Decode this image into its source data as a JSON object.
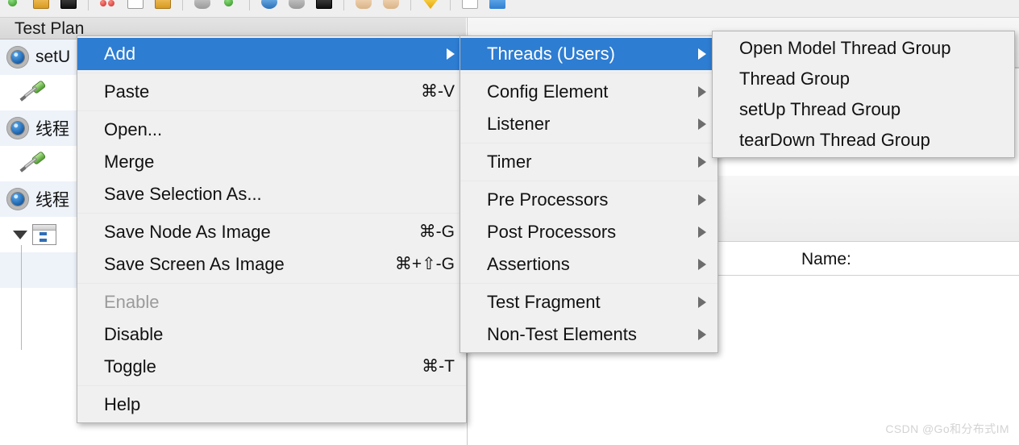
{
  "app": {
    "tree_header": "Test Plan",
    "watermark": "CSDN @Go和分布式IM"
  },
  "toolbar": {
    "icons": [
      {
        "name": "new-icon",
        "shape": "ico-green"
      },
      {
        "name": "open-folder-icon",
        "shape": "ico-folder"
      },
      {
        "name": "save-icon",
        "shape": "ico-disk"
      },
      {
        "name": "separator",
        "shape": "sep"
      },
      {
        "name": "cut-icon",
        "shape": "ico-dots"
      },
      {
        "name": "copy-icon",
        "shape": "ico-page"
      },
      {
        "name": "paste-icon",
        "shape": "ico-folder"
      },
      {
        "name": "separator",
        "shape": "sep"
      },
      {
        "name": "undo-icon",
        "shape": "ico-gray"
      },
      {
        "name": "redo-icon",
        "shape": "ico-green"
      },
      {
        "name": "separator",
        "shape": "sep"
      },
      {
        "name": "start-icon",
        "shape": "ico-multi"
      },
      {
        "name": "start-no-pause-icon",
        "shape": "ico-gray"
      },
      {
        "name": "stop-icon",
        "shape": "ico-disk"
      },
      {
        "name": "separator",
        "shape": "sep"
      },
      {
        "name": "shutdown-icon",
        "shape": "ico-hand"
      },
      {
        "name": "clear-icon",
        "shape": "ico-hand"
      },
      {
        "name": "separator",
        "shape": "sep"
      },
      {
        "name": "search-icon",
        "shape": "ico-shield"
      },
      {
        "name": "separator",
        "shape": "sep"
      },
      {
        "name": "function-helper-icon",
        "shape": "ico-white"
      },
      {
        "name": "help-icon",
        "shape": "ico-blue"
      }
    ]
  },
  "tree": {
    "header": "Test Plan",
    "rows": [
      {
        "icon": "gear-icon",
        "label": "setU",
        "kind": "gear",
        "selected": true
      },
      {
        "icon": "screwdriver-icon",
        "label": "",
        "kind": "screwdriver",
        "selected": false
      },
      {
        "icon": "gear-icon",
        "label": "线程",
        "kind": "gear",
        "selected": true
      },
      {
        "icon": "screwdriver-icon",
        "label": "",
        "kind": "screwdriver",
        "selected": false
      },
      {
        "icon": "gear-icon",
        "label": "线程",
        "kind": "gear",
        "selected": true
      },
      {
        "icon": "controller-icon",
        "label": "",
        "kind": "controller",
        "selected": false
      },
      {
        "icon": "child-node-icon",
        "label": "",
        "kind": "child",
        "selected": true
      },
      {
        "icon": "child-node-icon",
        "label": "",
        "kind": "child",
        "selected": false
      }
    ]
  },
  "content": {
    "name_label": "Name:"
  },
  "context_menu": {
    "name": "tree-context-menu",
    "items": [
      {
        "label": "Add",
        "accel": "",
        "submenu": true,
        "highlight": true,
        "disabled": false
      },
      {
        "separator_after": false
      },
      {
        "label": "Paste",
        "accel": "⌘-V",
        "submenu": false,
        "highlight": false,
        "disabled": false
      },
      {
        "label": "Open...",
        "accel": "",
        "submenu": false,
        "highlight": false,
        "disabled": false
      },
      {
        "label": "Merge",
        "accel": "",
        "submenu": false,
        "highlight": false,
        "disabled": false
      },
      {
        "label": "Save Selection As...",
        "accel": "",
        "submenu": false,
        "highlight": false,
        "disabled": false
      },
      {
        "label": "Save Node As Image",
        "accel": "⌘-G",
        "submenu": false,
        "highlight": false,
        "disabled": false
      },
      {
        "label": "Save Screen As Image",
        "accel": "⌘+⇧-G",
        "submenu": false,
        "highlight": false,
        "disabled": false
      },
      {
        "label": "Enable",
        "accel": "",
        "submenu": false,
        "highlight": false,
        "disabled": true
      },
      {
        "label": "Disable",
        "accel": "",
        "submenu": false,
        "highlight": false,
        "disabled": false
      },
      {
        "label": "Toggle",
        "accel": "⌘-T",
        "submenu": false,
        "highlight": false,
        "disabled": false
      },
      {
        "label": "Help",
        "accel": "",
        "submenu": false,
        "highlight": false,
        "disabled": false
      }
    ]
  },
  "add_submenu": {
    "name": "add-submenu",
    "items": [
      {
        "label": "Threads (Users)",
        "submenu": true,
        "highlight": true
      },
      {
        "label": "Config Element",
        "submenu": true,
        "highlight": false
      },
      {
        "label": "Listener",
        "submenu": true,
        "highlight": false
      },
      {
        "label": "Timer",
        "submenu": true,
        "highlight": false
      },
      {
        "label": "Pre Processors",
        "submenu": true,
        "highlight": false
      },
      {
        "label": "Post Processors",
        "submenu": true,
        "highlight": false
      },
      {
        "label": "Assertions",
        "submenu": true,
        "highlight": false
      },
      {
        "label": "Test Fragment",
        "submenu": true,
        "highlight": false
      },
      {
        "label": "Non-Test Elements",
        "submenu": true,
        "highlight": false
      }
    ]
  },
  "threads_submenu": {
    "name": "threads-users-submenu",
    "items": [
      {
        "label": "Open Model Thread Group"
      },
      {
        "label": "Thread Group"
      },
      {
        "label": "setUp Thread Group"
      },
      {
        "label": "tearDown Thread Group"
      }
    ]
  },
  "colors": {
    "menu_bg": "#f0f0f0",
    "menu_border": "#b4b4b4",
    "highlight": "#2d7dd2",
    "text": "#111111",
    "disabled_text": "#9b9b9b",
    "tree_selected": "#eef3fa",
    "watermark": "#d3d3d3"
  }
}
